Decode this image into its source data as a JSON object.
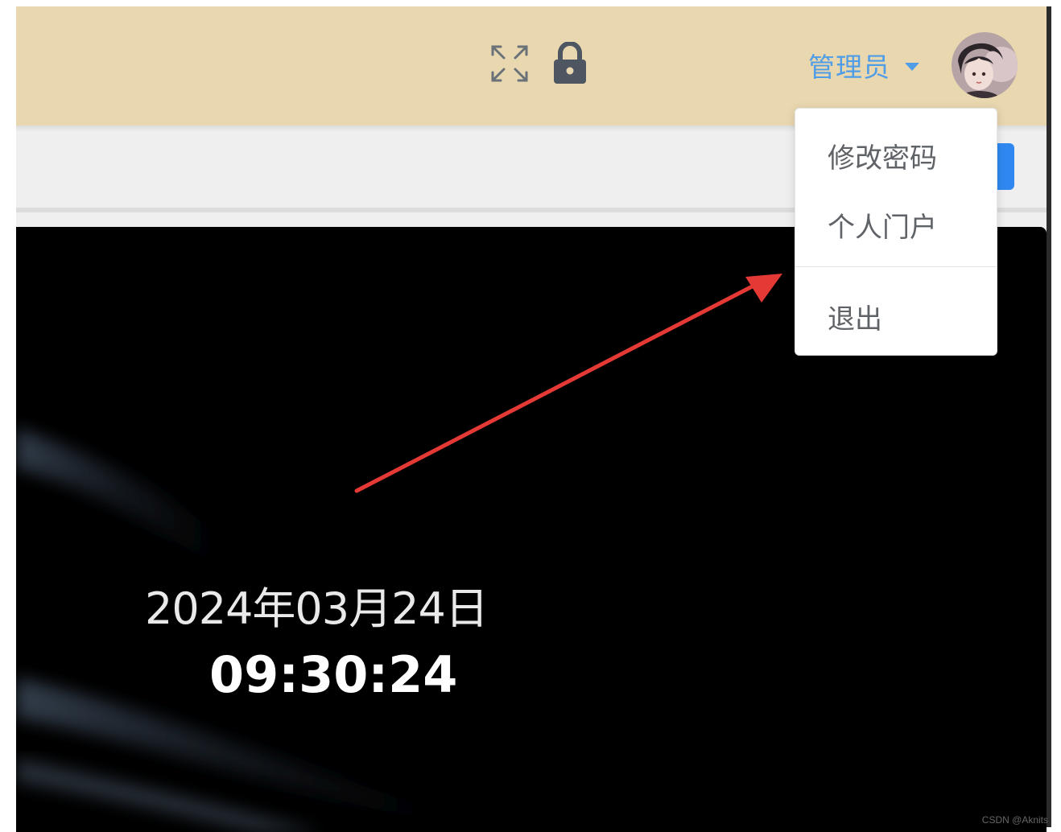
{
  "header": {
    "user_name": "管理员",
    "accent_color": "#4e9de6",
    "background_color": "#e9d7b0",
    "icons": [
      "fullscreen-icon",
      "lock-icon",
      "caret-down-icon"
    ]
  },
  "dropdown": {
    "items": [
      {
        "label": "修改密码"
      },
      {
        "label": "个人门户"
      },
      {
        "label": "退出"
      }
    ]
  },
  "main": {
    "date": "2024年03月24日",
    "time": "09:30:24"
  },
  "annotation": {
    "arrow_color": "#e53935"
  },
  "watermark": "CSDN @Aknits"
}
